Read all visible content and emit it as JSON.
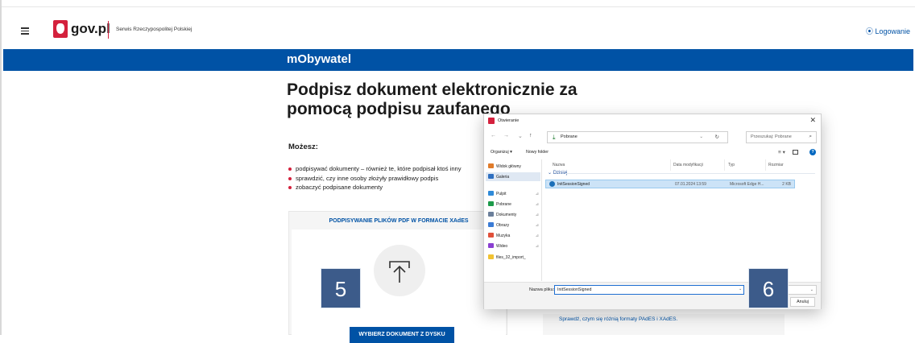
{
  "header": {
    "logo_text": "gov.pl",
    "service_name": "Serwis Rzeczypospolitej Polskiej",
    "login_label": "⦿ Logowanie"
  },
  "bluebar": {
    "title": "mObywatel"
  },
  "main": {
    "title": "Podpisz dokument elektronicznie za pomocą podpisu zaufanego",
    "can_label": "Możesz:",
    "bullets": [
      "podpisywać dokumenty – również te, które podpisał ktoś inny",
      "sprawdzić, czy inne osoby złożyły prawidłowy podpis",
      "zobaczyć podpisane dokumenty"
    ],
    "card_title": "PODPISYWANIE PLIKÓW PDF W FORMACIE XAdES",
    "choose_button": "WYBIERZ DOKUMENT Z DYSKU",
    "formats_link": "Sprawdź, czym się różnią formaty PAdES i XAdES."
  },
  "markers": {
    "left": "5",
    "right": "6"
  },
  "dialog": {
    "title": "Otwieranie",
    "close": "✕",
    "nav": {
      "back": "←",
      "forward": "→",
      "down": "⌄",
      "up": "↑"
    },
    "address": "Pobrane",
    "search_placeholder": "Przeszukaj: Pobrane",
    "toolbar": {
      "organize": "Organizuj ▾",
      "new_folder": "Nowy folder",
      "help": "?"
    },
    "nav_items": [
      {
        "label": "Widok główny",
        "icon": "home-icon",
        "color": "#e07b2a",
        "pinned": false
      },
      {
        "label": "Galeria",
        "icon": "gallery-icon",
        "color": "#2e6fc0",
        "pinned": false,
        "selected": true
      },
      {
        "label": "Pulpit",
        "icon": "desktop-icon",
        "color": "#2e8ad8",
        "pinned": true
      },
      {
        "label": "Pobrane",
        "icon": "download-icon",
        "color": "#1c9a4a",
        "pinned": true
      },
      {
        "label": "Dokumenty",
        "icon": "documents-icon",
        "color": "#6b7f9a",
        "pinned": true
      },
      {
        "label": "Obrazy",
        "icon": "pictures-icon",
        "color": "#3a7bd5",
        "pinned": true
      },
      {
        "label": "Muzyka",
        "icon": "music-icon",
        "color": "#e0503a",
        "pinned": true
      },
      {
        "label": "Wideo",
        "icon": "video-icon",
        "color": "#8a3fd1",
        "pinned": true
      },
      {
        "label": "files_32_import_",
        "icon": "folder-icon",
        "color": "#f1c232",
        "pinned": false
      }
    ],
    "columns": {
      "name": "Nazwa",
      "modified": "Data modyfikacji",
      "type": "Typ",
      "size": "Rozmiar"
    },
    "group": "⌄ Dzisiaj",
    "files": [
      {
        "name": "InitSessionSigned",
        "modified": "07.01.2024 13:59",
        "type": "Microsoft Edge H...",
        "size": "2 KB"
      }
    ],
    "filename_label": "Nazwa pliku:",
    "filename_value": "InitSessionSigned",
    "cancel_label": "Anuluj"
  }
}
